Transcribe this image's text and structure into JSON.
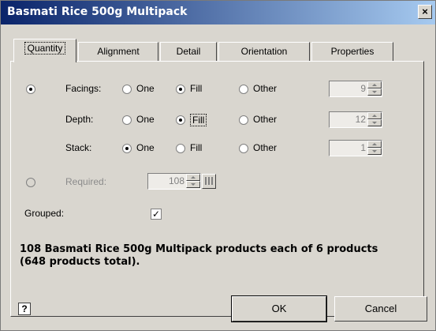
{
  "window": {
    "title": "Basmati Rice 500g Multipack",
    "close_symbol": "×"
  },
  "tabs": [
    {
      "label": "Quantity",
      "active": true
    },
    {
      "label": "Alignment"
    },
    {
      "label": "Detail"
    },
    {
      "label": "Orientation"
    },
    {
      "label": "Properties"
    }
  ],
  "rows": {
    "facings": {
      "label": "Facings:",
      "opt_one": "One",
      "opt_fill": "Fill",
      "opt_other": "Other",
      "value": "9"
    },
    "depth": {
      "label": "Depth:",
      "opt_one": "One",
      "opt_fill": "Fill",
      "opt_other": "Other",
      "value": "12"
    },
    "stack": {
      "label": "Stack:",
      "opt_one": "One",
      "opt_fill": "Fill",
      "opt_other": "Other",
      "value": "1"
    }
  },
  "required": {
    "label": "Required:",
    "value": "108"
  },
  "grouped": {
    "label": "Grouped:",
    "checked": true,
    "mark": "✓"
  },
  "summary": {
    "text": "108 Basmati Rice 500g Multipack products each of 6 products (648 products total)."
  },
  "buttons": {
    "ok": "OK",
    "cancel": "Cancel"
  },
  "help": {
    "symbol": "?"
  }
}
